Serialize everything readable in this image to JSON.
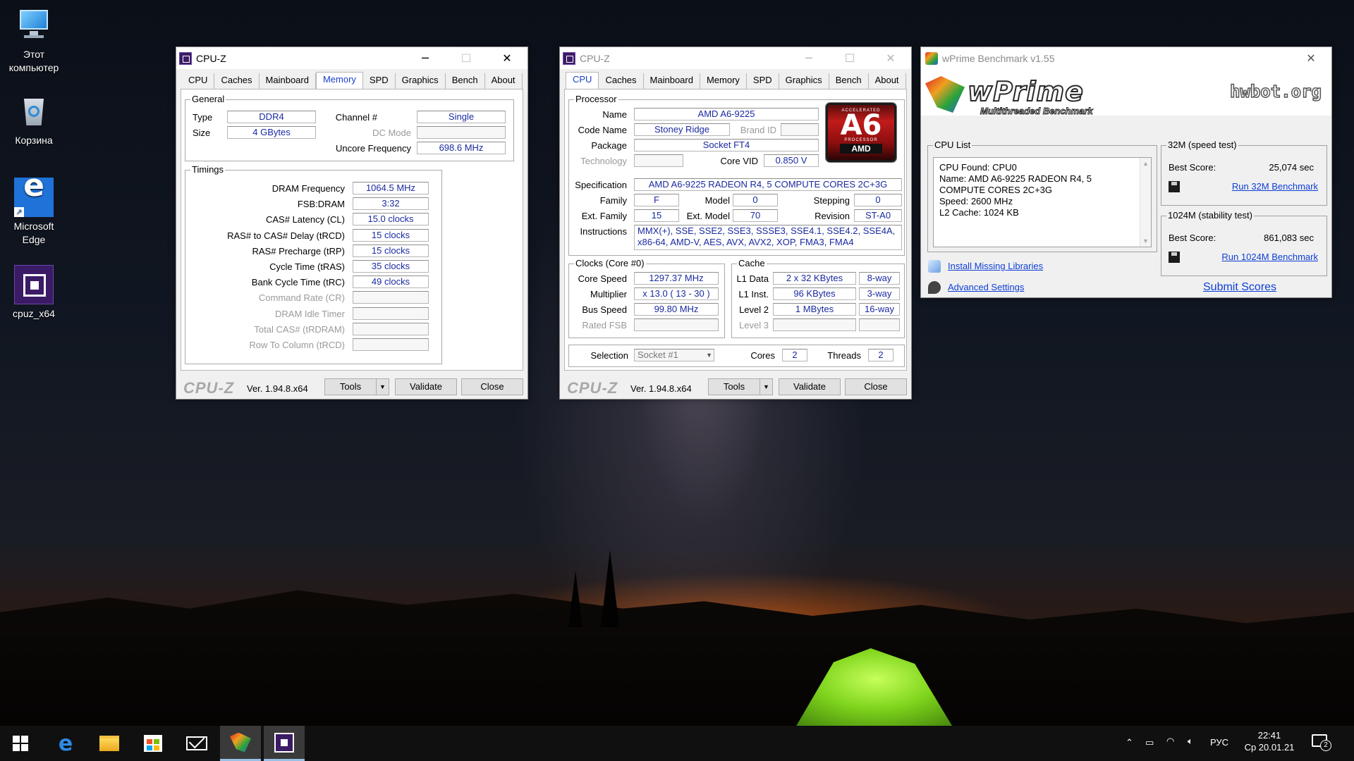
{
  "desktop": {
    "icons": [
      {
        "label_line1": "Этот",
        "label_line2": "компьютер"
      },
      {
        "label_line1": "Корзина",
        "label_line2": ""
      },
      {
        "label_line1": "Microsoft",
        "label_line2": "Edge"
      },
      {
        "label_line1": "cpuz_x64",
        "label_line2": ""
      }
    ]
  },
  "cpuz_memory": {
    "title": "CPU-Z",
    "tabs": [
      "CPU",
      "Caches",
      "Mainboard",
      "Memory",
      "SPD",
      "Graphics",
      "Bench",
      "About"
    ],
    "active_tab": "Memory",
    "general": {
      "group_title": "General",
      "type_label": "Type",
      "type_value": "DDR4",
      "size_label": "Size",
      "size_value": "4 GBytes",
      "channel_label": "Channel #",
      "channel_value": "Single",
      "dcmode_label": "DC Mode",
      "dcmode_value": "",
      "uncore_label": "Uncore Frequency",
      "uncore_value": "698.6 MHz"
    },
    "timings": {
      "group_title": "Timings",
      "rows": [
        {
          "label": "DRAM Frequency",
          "value": "1064.5 MHz",
          "dim": false
        },
        {
          "label": "FSB:DRAM",
          "value": "3:32",
          "dim": false
        },
        {
          "label": "CAS# Latency (CL)",
          "value": "15.0 clocks",
          "dim": false
        },
        {
          "label": "RAS# to CAS# Delay (tRCD)",
          "value": "15 clocks",
          "dim": false
        },
        {
          "label": "RAS# Precharge (tRP)",
          "value": "15 clocks",
          "dim": false
        },
        {
          "label": "Cycle Time (tRAS)",
          "value": "35 clocks",
          "dim": false
        },
        {
          "label": "Bank Cycle Time (tRC)",
          "value": "49 clocks",
          "dim": false
        },
        {
          "label": "Command Rate (CR)",
          "value": "",
          "dim": true
        },
        {
          "label": "DRAM Idle Timer",
          "value": "",
          "dim": true
        },
        {
          "label": "Total CAS# (tRDRAM)",
          "value": "",
          "dim": true
        },
        {
          "label": "Row To Column (tRCD)",
          "value": "",
          "dim": true
        }
      ]
    },
    "footer": {
      "logo": "CPU-Z",
      "version": "Ver. 1.94.8.x64",
      "tools": "Tools",
      "validate": "Validate",
      "close": "Close"
    }
  },
  "cpuz_cpu": {
    "title": "CPU-Z",
    "tabs": [
      "CPU",
      "Caches",
      "Mainboard",
      "Memory",
      "SPD",
      "Graphics",
      "Bench",
      "About"
    ],
    "active_tab": "CPU",
    "processor": {
      "group_title": "Processor",
      "name_label": "Name",
      "name_value": "AMD A6-9225",
      "codename_label": "Code Name",
      "codename_value": "Stoney Ridge",
      "brandid_label": "Brand ID",
      "brandid_value": "",
      "package_label": "Package",
      "package_value": "Socket FT4",
      "technology_label": "Technology",
      "technology_value": "",
      "corevid_label": "Core VID",
      "corevid_value": "0.850 V",
      "spec_label": "Specification",
      "spec_value": "AMD A6-9225 RADEON R4, 5 COMPUTE CORES 2C+3G",
      "family_label": "Family",
      "family_value": "F",
      "model_label": "Model",
      "model_value": "0",
      "stepping_label": "Stepping",
      "stepping_value": "0",
      "extfamily_label": "Ext. Family",
      "extfamily_value": "15",
      "extmodel_label": "Ext. Model",
      "extmodel_value": "70",
      "revision_label": "Revision",
      "revision_value": "ST-A0",
      "instructions_label": "Instructions",
      "instructions_line1": "MMX(+), SSE, SSE2, SSE3, SSSE3, SSE4.1, SSE4.2, SSE4A,",
      "instructions_line2": "x86-64, AMD-V, AES, AVX, AVX2, XOP, FMA3, FMA4"
    },
    "amd_badge": {
      "top": "ACCELERATED",
      "model": "A6",
      "proc": "PROCESSOR",
      "brand": "AMD"
    },
    "clocks": {
      "group_title": "Clocks (Core #0)",
      "corespeed_label": "Core Speed",
      "corespeed_value": "1297.37 MHz",
      "multiplier_label": "Multiplier",
      "multiplier_value": "x 13.0 ( 13 - 30 )",
      "busspeed_label": "Bus Speed",
      "busspeed_value": "99.80 MHz",
      "ratedfsb_label": "Rated FSB",
      "ratedfsb_value": ""
    },
    "cache": {
      "group_title": "Cache",
      "l1data_label": "L1 Data",
      "l1data_value": "2 x 32 KBytes",
      "l1data_way": "8-way",
      "l1inst_label": "L1 Inst.",
      "l1inst_value": "96 KBytes",
      "l1inst_way": "3-way",
      "level2_label": "Level 2",
      "level2_value": "1 MBytes",
      "level2_way": "16-way",
      "level3_label": "Level 3",
      "level3_value": "",
      "level3_way": ""
    },
    "selection": {
      "selection_label": "Selection",
      "selection_value": "Socket #1",
      "cores_label": "Cores",
      "cores_value": "2",
      "threads_label": "Threads",
      "threads_value": "2"
    },
    "footer": {
      "logo": "CPU-Z",
      "version": "Ver. 1.94.8.x64",
      "tools": "Tools",
      "validate": "Validate",
      "close": "Close"
    }
  },
  "wprime": {
    "title": "wPrime Benchmark v1.55",
    "logo": "wPrime",
    "subtitle": "Multithreaded Benchmark",
    "hwbot": "hwbot.org",
    "cpu_list": {
      "group_title": "CPU List",
      "lines": [
        "CPU Found: CPU0",
        "Name:    AMD A6-9225 RADEON R4, 5",
        "COMPUTE CORES 2C+3G",
        "Speed:    2600 MHz",
        "L2 Cache: 1024 KB"
      ]
    },
    "test32": {
      "group_title": "32M (speed test)",
      "best_label": "Best Score:",
      "best_value": "25,074 sec",
      "run_label": "Run 32M Benchmark"
    },
    "test1024": {
      "group_title": "1024M (stability test)",
      "best_label": "Best Score:",
      "best_value": "861,083 sec",
      "run_label": "Run 1024M Benchmark"
    },
    "install_label": "Install Missing Libraries",
    "advanced_label": "Advanced Settings",
    "submit_label": "Submit Scores"
  },
  "taskbar": {
    "tray_language": "РУС",
    "clock_time": "22:41",
    "clock_date": "Ср 20.01.21",
    "notification_count": "2"
  }
}
